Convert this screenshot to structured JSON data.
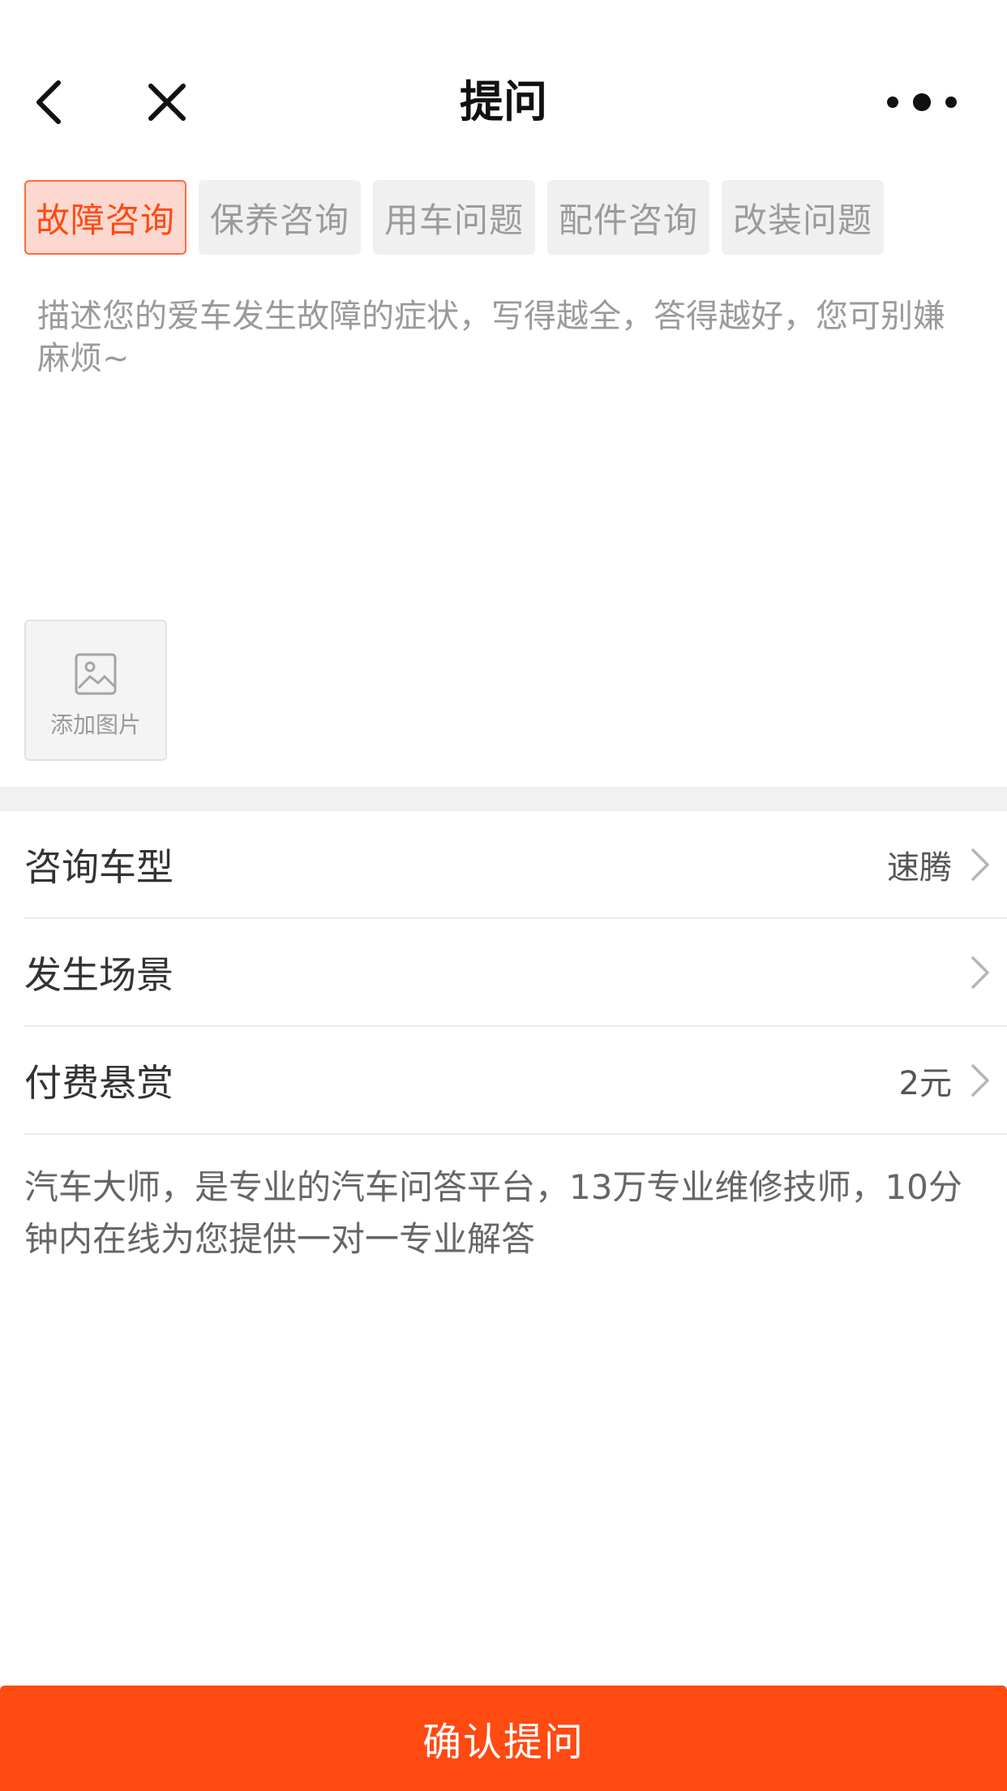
{
  "header": {
    "title": "提问"
  },
  "tabs": [
    {
      "label": "故障咨询",
      "active": true
    },
    {
      "label": "保养咨询",
      "active": false
    },
    {
      "label": "用车问题",
      "active": false
    },
    {
      "label": "配件咨询",
      "active": false
    },
    {
      "label": "改装问题",
      "active": false
    }
  ],
  "description": {
    "placeholder": "描述您的爱车发生故障的症状，写得越全，答得越好，您可别嫌麻烦~"
  },
  "add_image": {
    "label": "添加图片"
  },
  "rows": [
    {
      "label": "咨询车型",
      "value": "速腾"
    },
    {
      "label": "发生场景",
      "value": ""
    },
    {
      "label": "付费悬赏",
      "value": "2元"
    }
  ],
  "info": {
    "text": "汽车大师，是专业的汽车问答平台，13万专业维修技师，10分钟内在线为您提供一对一专业解答"
  },
  "confirm": {
    "label": "确认提问"
  },
  "colors": {
    "accent": "#ff4a12",
    "tab_active_bg": "#fdd8d0",
    "tab_bg": "#f1f0f0",
    "band": "#f2f1f1"
  },
  "icons": {
    "back": "chevron-left-icon",
    "close": "close-icon",
    "more": "more-dots-icon",
    "image": "image-icon",
    "chevron": "chevron-right-icon"
  }
}
